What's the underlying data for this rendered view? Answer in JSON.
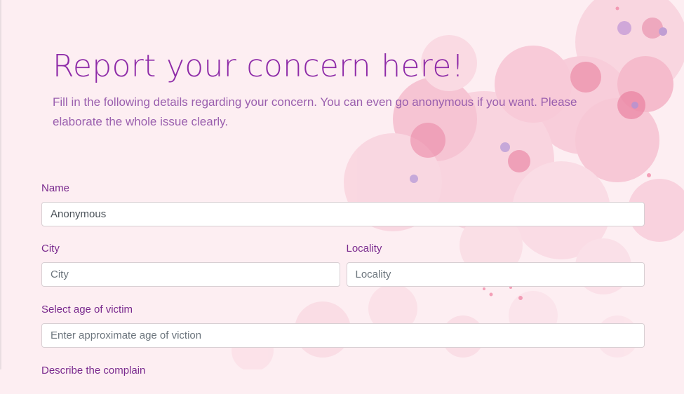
{
  "hero": {
    "title": "Report your concern here!",
    "subtitle": "Fill in the following details regarding your concern. You can even go anonymous if you want. Please elaborate the whole issue clearly."
  },
  "form": {
    "name": {
      "label": "Name",
      "value": "Anonymous"
    },
    "city": {
      "label": "City",
      "placeholder": "City"
    },
    "locality": {
      "label": "Locality",
      "placeholder": "Locality"
    },
    "age": {
      "label": "Select age of victim",
      "placeholder": "Enter approximate age of viction"
    },
    "describe": {
      "label": "Describe the complain"
    }
  },
  "colors": {
    "background": "#fdeef2",
    "accent": "#8e2ba8",
    "label": "#7a2a8e",
    "subtitle": "#9a5fae",
    "flower": "#f4a6bd"
  },
  "decoration": {
    "background_art": "watercolor-pink-flowers"
  }
}
